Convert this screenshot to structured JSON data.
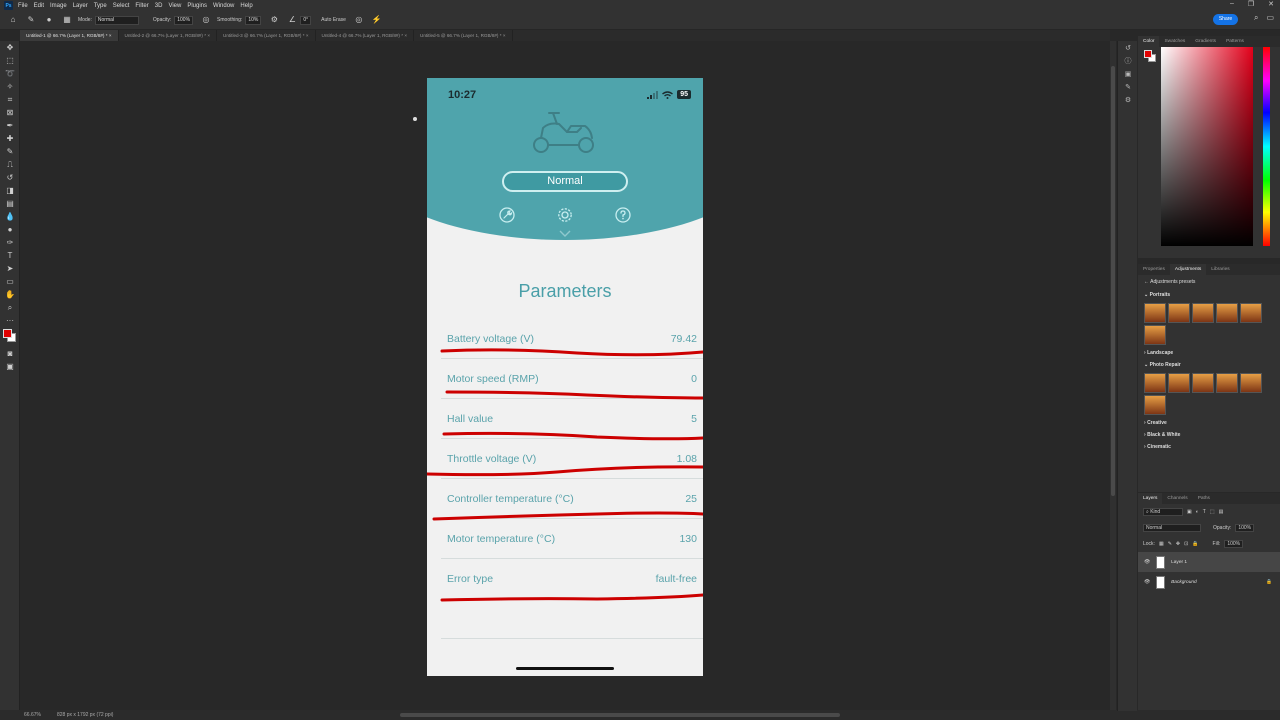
{
  "menu": {
    "items": [
      "File",
      "Edit",
      "Image",
      "Layer",
      "Type",
      "Select",
      "Filter",
      "3D",
      "View",
      "Plugins",
      "Window",
      "Help"
    ],
    "app_icon": "Ps"
  },
  "options_bar": {
    "mode_label": "Mode:",
    "mode_value": "Normal",
    "opacity_label": "Opacity:",
    "opacity_value": "100%",
    "smoothing_label": "Smoothing:",
    "smoothing_value": "10%",
    "angle_value": "0°",
    "auto_erase_label": "Auto Erase",
    "share_label": "Share"
  },
  "tabs": [
    "Untitled-1 @ 66.7% (Layer 1, RGB/8#) *",
    "Untitled-2 @ 66.7% (Layer 1, RGB/8#) *",
    "Untitled-3 @ 66.7% (Layer 1, RGB/8#) *",
    "Untitled-4 @ 66.7% (Layer 1, RGB/8#) *",
    "Untitled-5 @ 66.7% (Layer 1, RGB/8#) *"
  ],
  "status_bar": {
    "zoom": "66.67%",
    "doc_size": "828 px x 1792 px (72 ppi)"
  },
  "phone": {
    "time": "10:27",
    "battery": "95",
    "mode": "Normal",
    "title": "Parameters",
    "rows": [
      {
        "label": "Battery voltage (V)",
        "value": "79.42"
      },
      {
        "label": "Motor speed (RMP)",
        "value": "0"
      },
      {
        "label": "Hall value",
        "value": "5"
      },
      {
        "label": "Throttle voltage (V)",
        "value": "1.08"
      },
      {
        "label": "Controller temperature (°C)",
        "value": "25"
      },
      {
        "label": "Motor temperature  (°C)",
        "value": "130"
      },
      {
        "label": "Error type",
        "value": "fault-free"
      }
    ],
    "icons": [
      "wrench-icon",
      "gear-icon",
      "help-icon",
      "scooter-icon",
      "chevron-down-icon"
    ],
    "header_color": "#4fa4ac",
    "text_color": "#5aa3ab",
    "annotation_color": "#cc0000"
  },
  "panels": {
    "color_tabs": [
      "Color",
      "Swatches",
      "Gradients",
      "Patterns"
    ],
    "adjust_tabs": [
      "Properties",
      "Adjustments",
      "Libraries"
    ],
    "adjust_title": "Adjustments presets",
    "adjust_sections": [
      "Portraits",
      "Landscape",
      "Photo Repair",
      "Creative",
      "Black & White",
      "Cinematic"
    ],
    "layers_tabs": [
      "Layers",
      "Channels",
      "Paths"
    ],
    "layers_kind": "Kind",
    "blend_mode": "Normal",
    "opacity_label": "Opacity:",
    "opacity_value": "100%",
    "lock_label": "Lock:",
    "fill_label": "Fill:",
    "fill_value": "100%",
    "layers": [
      "Layer 1",
      "Background"
    ]
  }
}
